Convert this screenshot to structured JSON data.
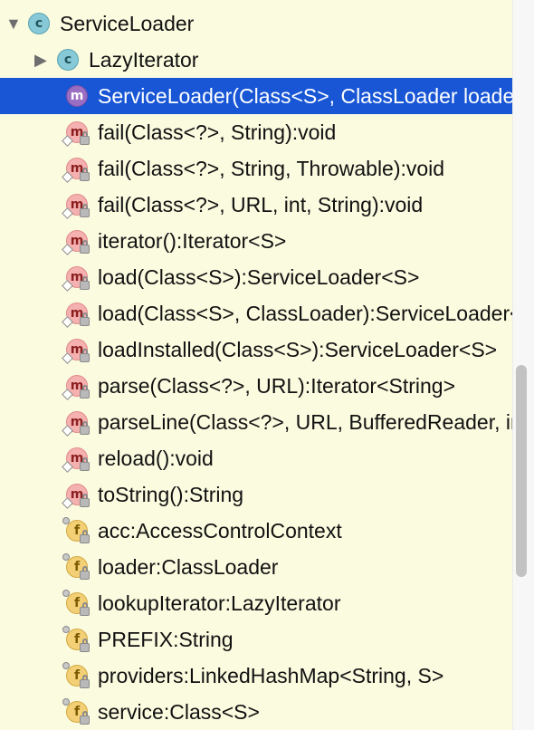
{
  "tree": {
    "root": {
      "label": "ServiceLoader",
      "icon": "class-icon",
      "expanded": true
    },
    "nested": {
      "label": "LazyIterator",
      "icon": "class-icon",
      "expanded": false
    },
    "members": [
      {
        "label": "ServiceLoader(Class<S>, ClassLoader loader)",
        "kind": "method",
        "selected": true
      },
      {
        "label": "fail(Class<?>, String):void",
        "kind": "method"
      },
      {
        "label": "fail(Class<?>, String, Throwable):void",
        "kind": "method"
      },
      {
        "label": "fail(Class<?>, URL, int, String):void",
        "kind": "method"
      },
      {
        "label": "iterator():Iterator<S>",
        "kind": "method"
      },
      {
        "label": "load(Class<S>):ServiceLoader<S>",
        "kind": "method"
      },
      {
        "label": "load(Class<S>, ClassLoader):ServiceLoader<S>",
        "kind": "method"
      },
      {
        "label": "loadInstalled(Class<S>):ServiceLoader<S>",
        "kind": "method"
      },
      {
        "label": "parse(Class<?>, URL):Iterator<String>",
        "kind": "method"
      },
      {
        "label": "parseLine(Class<?>, URL, BufferedReader, int, List<String>):int",
        "kind": "method"
      },
      {
        "label": "reload():void",
        "kind": "method"
      },
      {
        "label": "toString():String",
        "kind": "method"
      },
      {
        "label": "acc:AccessControlContext",
        "kind": "field"
      },
      {
        "label": "loader:ClassLoader",
        "kind": "field"
      },
      {
        "label": "lookupIterator:LazyIterator",
        "kind": "field"
      },
      {
        "label": "PREFIX:String",
        "kind": "field"
      },
      {
        "label": "providers:LinkedHashMap<String, S>",
        "kind": "field"
      },
      {
        "label": "service:Class<S>",
        "kind": "field"
      }
    ]
  },
  "icon_letters": {
    "class": "c",
    "method": "m",
    "field": "f"
  },
  "colors": {
    "background": "#fbfbe0",
    "selection": "#1856d6",
    "class_icon": "#87c9d6",
    "method_icon": "#f5b0b0",
    "field_icon": "#f3cf75"
  },
  "scroll": {
    "thumb_fraction_start": 0.5,
    "thumb_fraction_size": 0.29
  }
}
